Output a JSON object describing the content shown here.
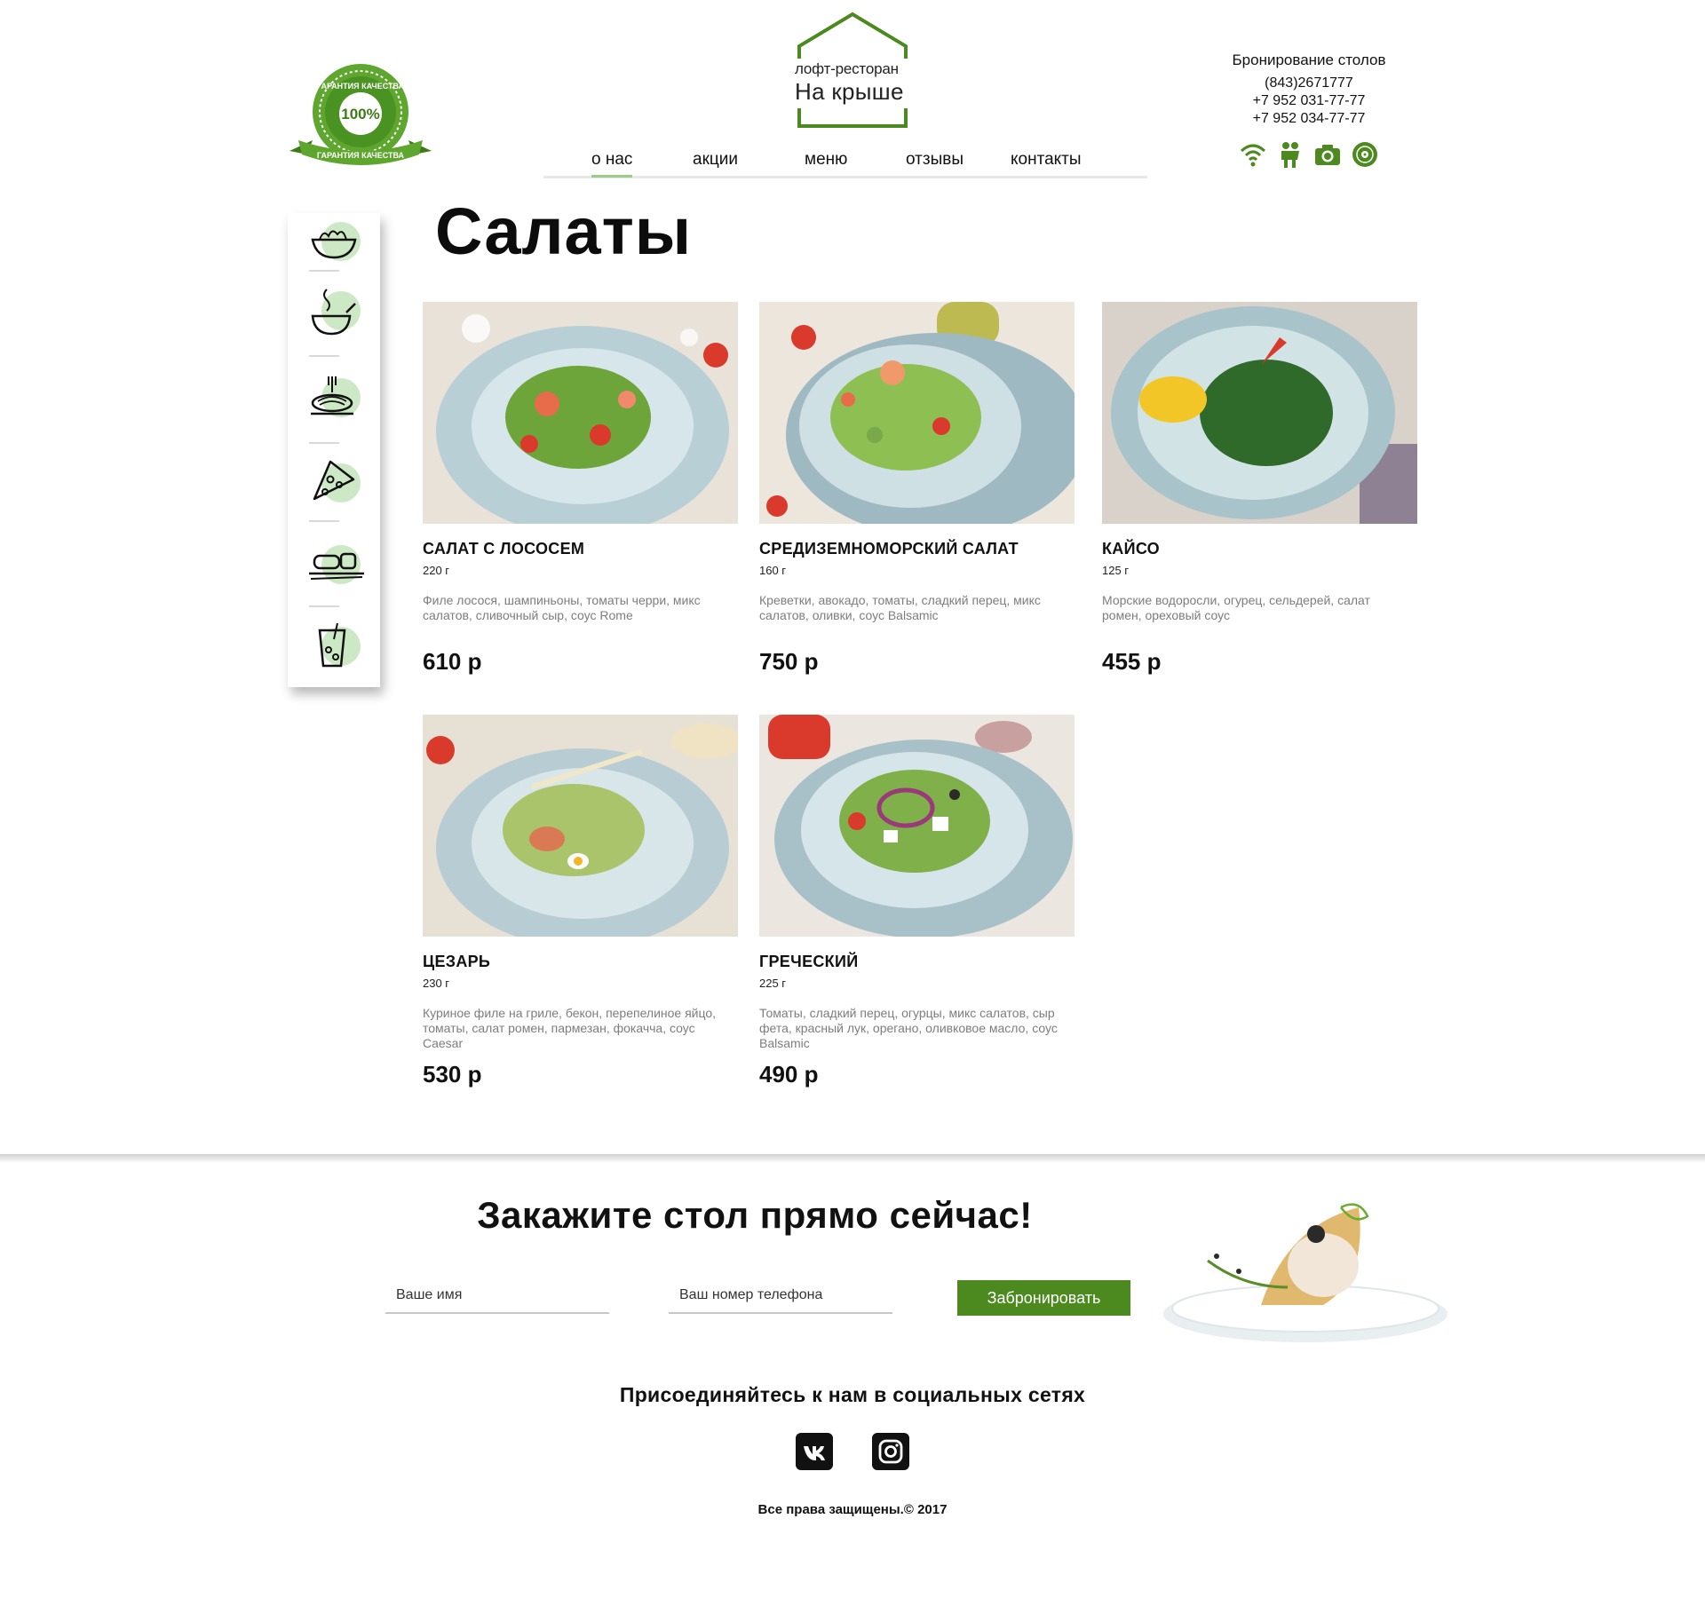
{
  "brand": {
    "logo_small": "лофт-ресторан",
    "logo_big": "На крыше",
    "badge_arc": "ГАРАНТИЯ КАЧЕСТВА",
    "badge_percent": "100%",
    "badge_ribbon": "ГАРАНТИЯ КАЧЕСТВА",
    "accent_color": "#4c8a1f",
    "light_green": "#cde8c5"
  },
  "nav": {
    "items": [
      {
        "label": "о нас",
        "active": true
      },
      {
        "label": "акции",
        "active": false
      },
      {
        "label": "меню",
        "active": false
      },
      {
        "label": "отзывы",
        "active": false
      },
      {
        "label": "контакты",
        "active": false
      }
    ]
  },
  "booking": {
    "title": "Бронирование столов",
    "phones": [
      "(843)2671777",
      "+7 952 031-77-77",
      "+7 952 034-77-77"
    ],
    "feature_icons": [
      "wifi-icon",
      "couple-icon",
      "camera-icon",
      "vinyl-record-icon"
    ]
  },
  "sidebar": {
    "categories": [
      "salad-bowl-icon",
      "soup-icon",
      "pasta-icon",
      "pizza-slice-icon",
      "sushi-icon",
      "drink-icon"
    ]
  },
  "page": {
    "title": "Салаты"
  },
  "dishes": [
    {
      "name": "САЛАТ С ЛОСОСЕМ",
      "weight": "220 г",
      "description": "Филе лосося, шампиньоны, томаты черри, микс салатов, сливочный сыр, соус Rome",
      "price": "610 р"
    },
    {
      "name": "СРЕДИЗЕМНОМОРСКИЙ САЛАТ",
      "weight": "160 г",
      "description": "Креветки, авокадо, томаты, сладкий перец, микс салатов, оливки, соус Balsamic",
      "price": "750 р"
    },
    {
      "name": "КАЙСО",
      "weight": "125 г",
      "description": "Морские водоросли, огурец, сельдерей, салат ромен, ореховый соус",
      "price": "455 р"
    },
    {
      "name": "ЦЕЗАРЬ",
      "weight": "230 г",
      "description": "Куриное филе на гриле, бекон, перепелиное яйцо, томаты, салат ромен, пармезан, фокачча, соус Caesar",
      "price": "530 р"
    },
    {
      "name": "ГРЕЧЕСКИЙ",
      "weight": "225 г",
      "description": "Томаты, сладкий перец, огурцы, микс салатов, сыр фета, красный лук, орегано, оливковое масло, соус Balsamic",
      "price": "490 р"
    }
  ],
  "reservation": {
    "title": "Закажите стол прямо сейчас!",
    "name_placeholder": "Ваше имя",
    "phone_placeholder": "Ваш номер телефона",
    "button": "Забронировать"
  },
  "social": {
    "title": "Присоединяйтесь к нам в социальных сетях",
    "networks": [
      "vk-icon",
      "instagram-icon"
    ]
  },
  "footer": {
    "copyright": "Все права защищены.© 2017"
  }
}
